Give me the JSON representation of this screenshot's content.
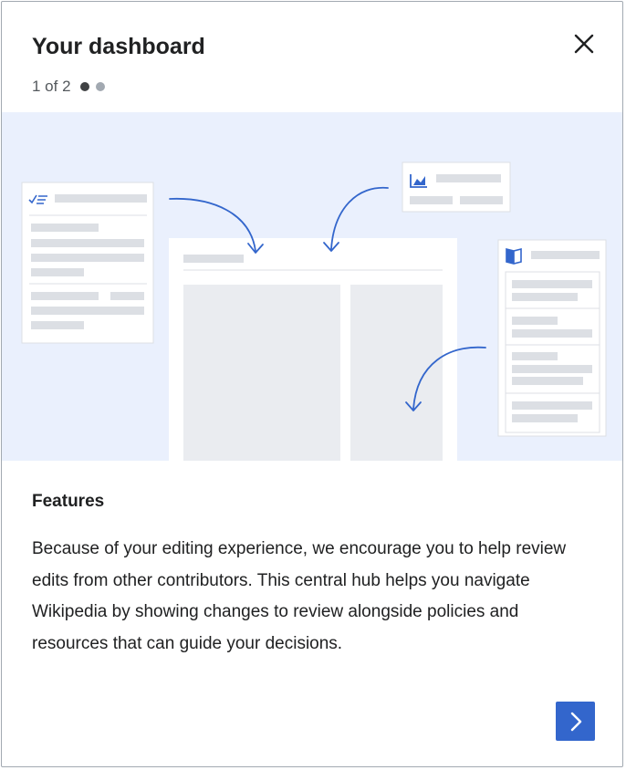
{
  "dialog": {
    "title": "Your dashboard",
    "close_icon": "close-icon",
    "stepper": {
      "text": "1 of 2",
      "current": 1,
      "total": 2,
      "active_color": "#404244",
      "inactive_color": "#a2a9b1"
    }
  },
  "illustration": {
    "description_icons": [
      "checklist-icon",
      "chart-icon",
      "book-icon"
    ],
    "accent_color": "#3366cc",
    "background_color": "#eaf0fd"
  },
  "content": {
    "heading": "Features",
    "body": "Because of your editing experience, we encourage you to help review edits from other contributors. This central hub helps you navigate Wikipedia by showing changes to review alongside policies and resources that can guide your decisions."
  },
  "footer": {
    "next_icon": "chevron-right-icon",
    "next_button_color": "#3366cc"
  }
}
